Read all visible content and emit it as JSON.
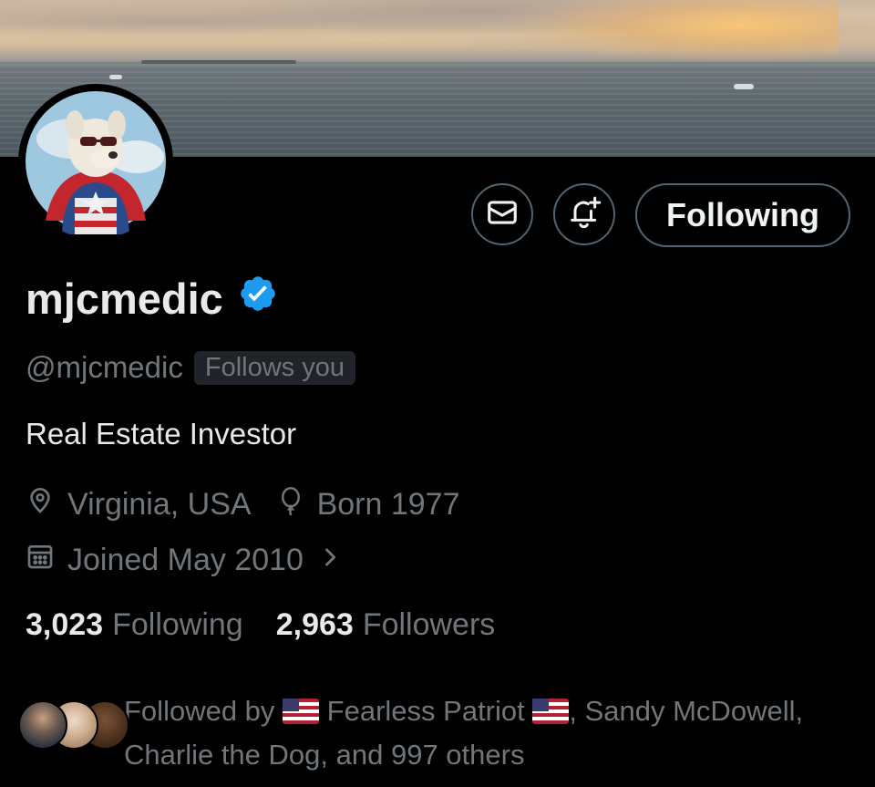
{
  "profile": {
    "display_name": "mjcmedic",
    "handle": "@mjcmedic",
    "follows_you_badge": "Follows you",
    "bio": "Real Estate Investor",
    "location": "Virginia, USA",
    "born": "Born 1977",
    "joined": "Joined May 2010"
  },
  "actions": {
    "following_button": "Following"
  },
  "stats": {
    "following_count": "3,023",
    "following_label": "Following",
    "followers_count": "2,963",
    "followers_label": "Followers"
  },
  "followed_by": {
    "prefix": "Followed by",
    "first_name": "Fearless Patriot",
    "rest": ", Sandy McDowell, Charlie the Dog, and 997 others"
  },
  "icons": {
    "message": "envelope-icon",
    "notify": "bell-plus-icon",
    "verified": "verified-badge-icon",
    "location": "location-pin-icon",
    "born": "balloon-icon",
    "joined": "calendar-icon",
    "chevron": "chevron-right-icon",
    "flag": "us-flag-icon"
  },
  "colors": {
    "background": "#000000",
    "primary_text": "#e7e9ea",
    "secondary_text": "#71767b",
    "border": "#536471",
    "verified_blue": "#1d9bf0",
    "badge_bg": "#202327"
  }
}
